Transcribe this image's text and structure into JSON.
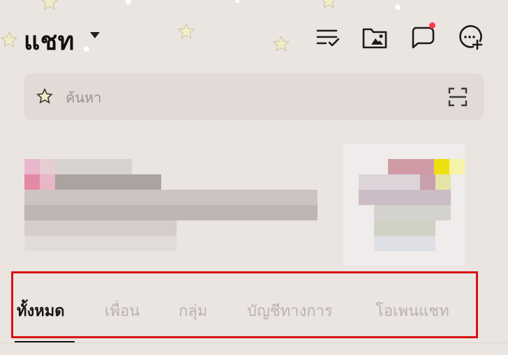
{
  "header": {
    "title": "แชท",
    "icons": [
      "sort-check-icon",
      "photo-folder-icon",
      "chat-bubble-icon",
      "add-chat-icon"
    ]
  },
  "search": {
    "placeholder": "ค้นหา"
  },
  "tabs": [
    {
      "label": "ทั้งหมด",
      "active": true
    },
    {
      "label": "เพื่อน",
      "active": false
    },
    {
      "label": "กลุ่ม",
      "active": false
    },
    {
      "label": "บัญชีทางการ",
      "active": false
    },
    {
      "label": "โอเพนแชท",
      "active": false
    }
  ],
  "colors": {
    "background": "#ebe5e1",
    "search_bg": "#e1dad6",
    "active_tab": "#141414",
    "inactive_tab": "#b9b2ae",
    "highlight": "#d81313",
    "notification_dot": "#ff3b47"
  }
}
